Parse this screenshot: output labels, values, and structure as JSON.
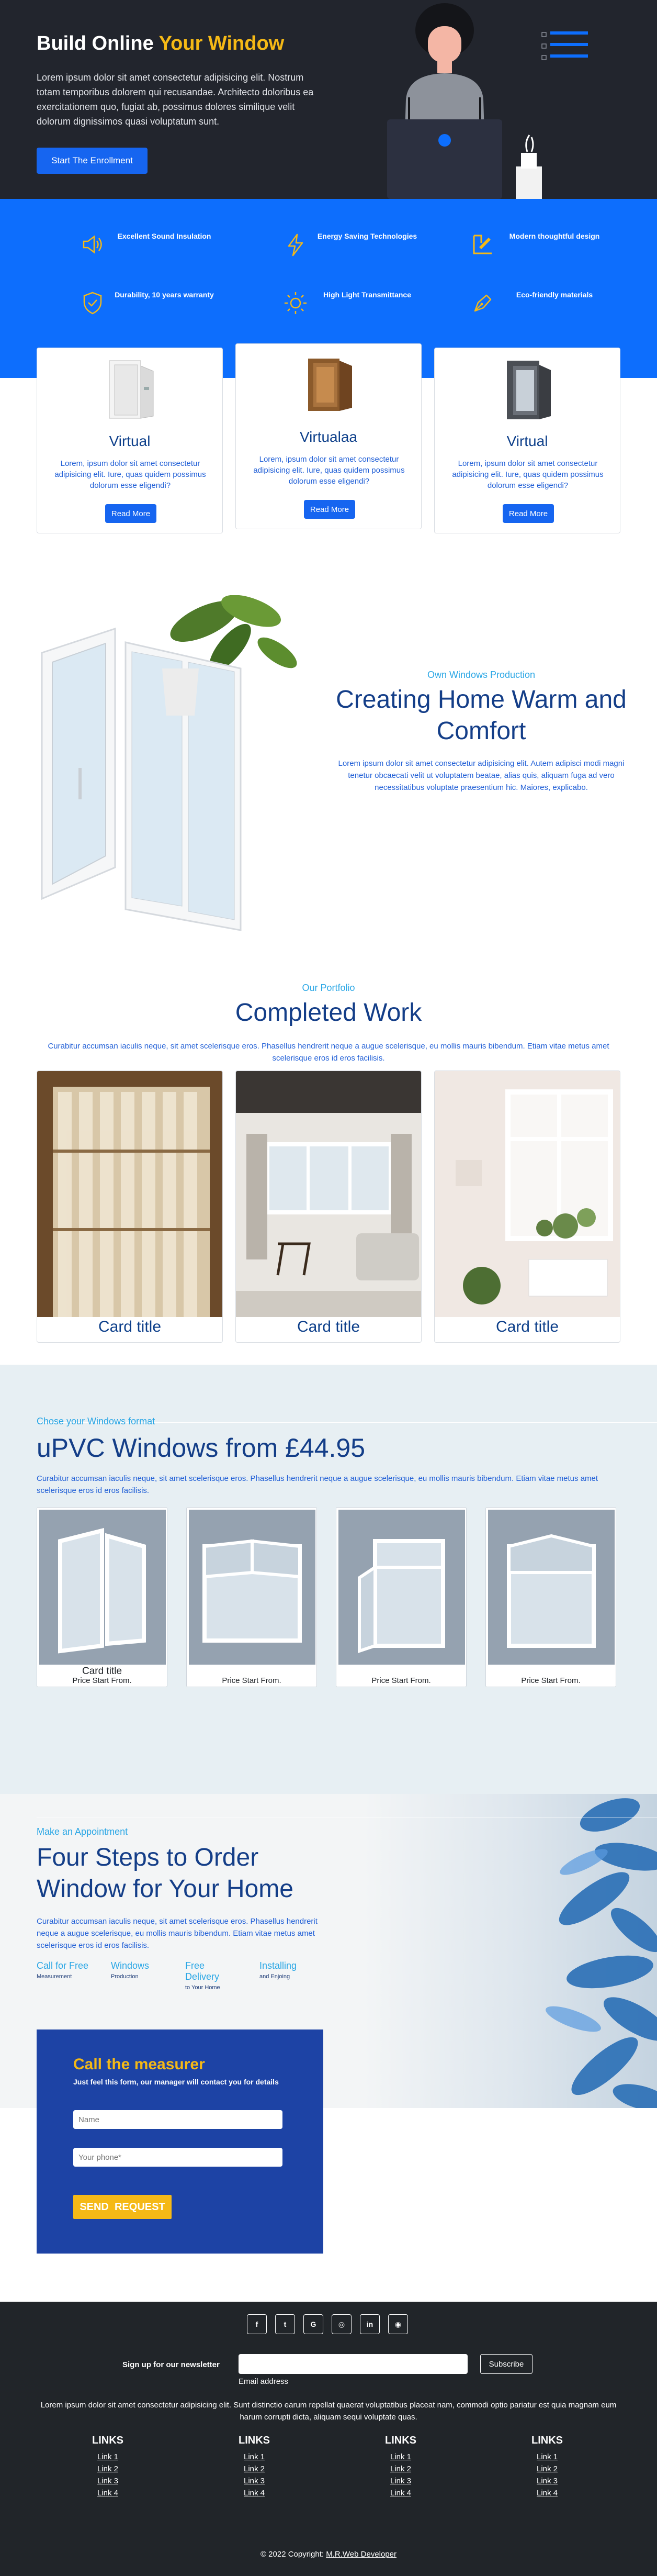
{
  "hero": {
    "title_start": "Build Online ",
    "title_accent": "Your Window",
    "text": "Lorem ipsum dolor sit amet consectetur adipisicing elit. Nostrum totam temporibus dolorem qui recusandae. Architecto doloribus ea exercitationem quo, fugiat ab, possimus dolores similique velit dolorum dignissimos quasi voluptatum sunt.",
    "button": "Start The Enrollment"
  },
  "features": [
    {
      "icon": "speaker-icon",
      "label": "Excellent Sound Insulation"
    },
    {
      "icon": "lightning-icon",
      "label": "Energy Saving Technologies"
    },
    {
      "icon": "design-tools-icon",
      "label": "Modern thoughtful design"
    },
    {
      "icon": "shield-check-icon",
      "label": "Durability, 10 years warranty"
    },
    {
      "icon": "sun-icon",
      "label": "High Light Transmittance"
    },
    {
      "icon": "pen-leaf-icon",
      "label": "Eco-friendly materials"
    }
  ],
  "products": [
    {
      "title": "Virtual",
      "text": "Lorem, ipsum dolor sit amet consectetur adipisicing elit. Iure, quas quidem possimus dolorum esse eligendi?",
      "button": "Read More"
    },
    {
      "title": "Virtualaa",
      "text": "Lorem, ipsum dolor sit amet consectetur adipisicing elit. Iure, quas quidem possimus dolorum esse eligendi?",
      "button": "Read More"
    },
    {
      "title": "Virtual",
      "text": "Lorem, ipsum dolor sit amet consectetur adipisicing elit. Iure, quas quidem possimus dolorum esse eligendi?",
      "button": "Read More"
    }
  ],
  "about": {
    "kicker": "Own Windows Production",
    "title": "Creating Home Warm and Comfort",
    "text": "Lorem ipsum dolor sit amet consectetur adipisicing elit. Autem adipisci modi magni tenetur obcaecati velit ut voluptatem beatae, alias quis, aliquam fuga ad vero necessitatibus voluptate praesentium hic. Maiores, explicabo."
  },
  "portfolio": {
    "kicker": "Our Portfolio",
    "title": "Completed Work",
    "text": "Curabitur accumsan iaculis neque, sit amet scelerisque eros. Phasellus hendrerit neque a augue scelerisque, eu mollis mauris bibendum. Etiam vitae metus amet scelerisque eros id eros facilisis.",
    "cards": [
      {
        "title": "Card title"
      },
      {
        "title": "Card title"
      },
      {
        "title": "Card title"
      }
    ]
  },
  "upvc": {
    "kicker": "Chose your Windows format",
    "title": "uPVC Windows from £44.95",
    "text": "Curabitur accumsan iaculis neque, sit amet scelerisque eros. Phasellus hendrerit neque a augue scelerisque, eu mollis mauris bibendum. Etiam vitae metus amet scelerisque eros id eros facilisis.",
    "cards": [
      {
        "title": "Card title",
        "price": "Price Start From."
      },
      {
        "title": "",
        "price": "Price Start From."
      },
      {
        "title": "",
        "price": "Price Start From."
      },
      {
        "title": "",
        "price": "Price Start From."
      }
    ]
  },
  "steps": {
    "kicker": "Make an Appointment",
    "title": "Four Steps to Order Window for Your Home",
    "text": "Curabitur accumsan iaculis neque, sit amet scelerisque eros. Phasellus hendrerit neque a augue scelerisque, eu mollis mauris bibendum. Etiam vitae metus amet scelerisque eros id eros facilisis.",
    "items": [
      {
        "label": "Call for Free",
        "sub": "Measurement"
      },
      {
        "label": "Windows",
        "sub": "Production"
      },
      {
        "label": "Free Delivery",
        "sub": "to Your Home"
      },
      {
        "label": "Installing",
        "sub": "and Enjoing"
      }
    ]
  },
  "form": {
    "title": "Call the measurer",
    "subtitle": "Just feel this form, our manager will contact you for details",
    "name_placeholder": "Name",
    "phone_placeholder": "Your phone*",
    "button": "SEND  REQUEST"
  },
  "footer": {
    "social": [
      {
        "icon": "facebook-icon",
        "glyph": "f"
      },
      {
        "icon": "twitter-icon",
        "glyph": "t"
      },
      {
        "icon": "google-icon",
        "glyph": "G"
      },
      {
        "icon": "instagram-icon",
        "glyph": "◎"
      },
      {
        "icon": "linkedin-icon",
        "glyph": "in"
      },
      {
        "icon": "github-icon",
        "glyph": "◉"
      }
    ],
    "newsletter_label": "Sign up for our newsletter",
    "email_caption": "Email address",
    "subscribe": "Subscribe",
    "text": "Lorem ipsum dolor sit amet consectetur adipisicing elit. Sunt distinctio earum repellat quaerat voluptatibus placeat nam, commodi optio pariatur est quia magnam eum harum corrupti dicta, aliquam sequi voluptate quas.",
    "columns": [
      {
        "heading": "LINKS",
        "links": [
          "Link 1",
          "Link 2",
          "Link 3",
          "Link 4"
        ]
      },
      {
        "heading": "LINKS",
        "links": [
          "Link 1",
          "Link 2",
          "Link 3",
          "Link 4"
        ]
      },
      {
        "heading": "LINKS",
        "links": [
          "Link 1",
          "Link 2",
          "Link 3",
          "Link 4"
        ]
      },
      {
        "heading": "LINKS",
        "links": [
          "Link 1",
          "Link 2",
          "Link 3",
          "Link 4"
        ]
      }
    ],
    "copyright_prefix": "© 2022 Copyright: ",
    "copyright_link": "M.R.Web Developer"
  },
  "colors": {
    "primary": "#0d6efd",
    "dark": "#22252d",
    "accent": "#f5b916",
    "heading": "#143e88",
    "form_bg": "#1d43a5",
    "light_bg": "#e7eff3"
  }
}
